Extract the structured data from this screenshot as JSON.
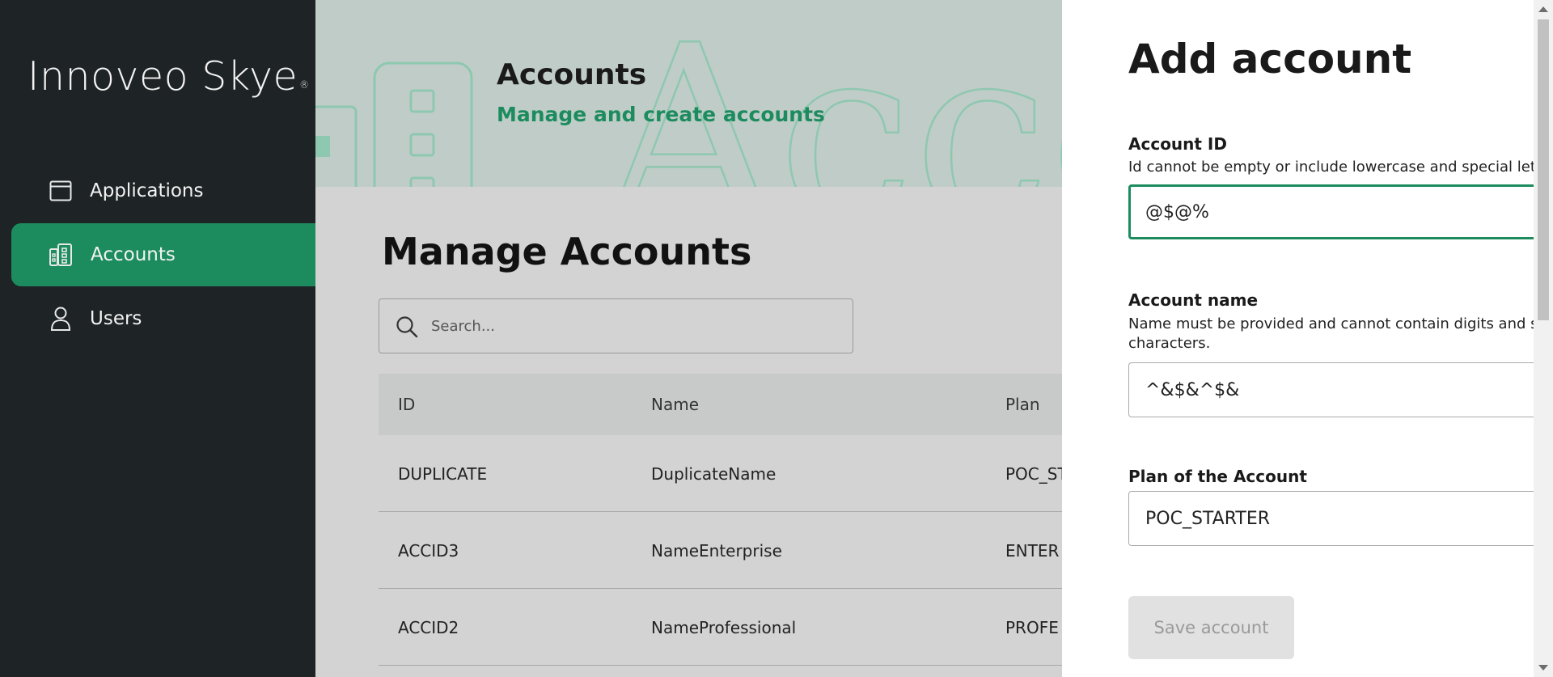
{
  "sidebar": {
    "logo": "Innoveo Skye",
    "logo_mark": "®",
    "items": [
      {
        "label": "Applications",
        "icon": "window-icon",
        "active": false
      },
      {
        "label": "Accounts",
        "icon": "building-icon",
        "active": true
      },
      {
        "label": "Users",
        "icon": "user-icon",
        "active": false
      }
    ]
  },
  "banner": {
    "title": "Accounts",
    "subtitle": "Manage and create accounts",
    "watermark": "Acco"
  },
  "main": {
    "title": "Manage Accounts",
    "search": {
      "placeholder": "Search...",
      "value": ""
    },
    "table": {
      "columns": [
        "ID",
        "Name",
        "Plan"
      ],
      "rows": [
        {
          "id": "DUPLICATE",
          "name": "DuplicateName",
          "plan": "POC_ST"
        },
        {
          "id": "ACCID3",
          "name": "NameEnterprise",
          "plan": "ENTER"
        },
        {
          "id": "ACCID2",
          "name": "NameProfessional",
          "plan": "PROFE"
        }
      ]
    }
  },
  "panel": {
    "title": "Add account",
    "account_id": {
      "label": "Account ID",
      "help": "Id cannot be empty or include lowercase and special letters",
      "value": "@$@%"
    },
    "account_name": {
      "label": "Account name",
      "help": "Name must be provided and cannot contain digits and special characters.",
      "value": "^&$&^$&"
    },
    "plan": {
      "label": "Plan of the Account",
      "value": "POC_STARTER"
    },
    "save_label": "Save account"
  },
  "colors": {
    "accent": "#1c8c5e",
    "sidebar_bg": "#1e2326",
    "banner_bg": "#c0ccc8",
    "overlay_bg": "#d3d3d3"
  }
}
